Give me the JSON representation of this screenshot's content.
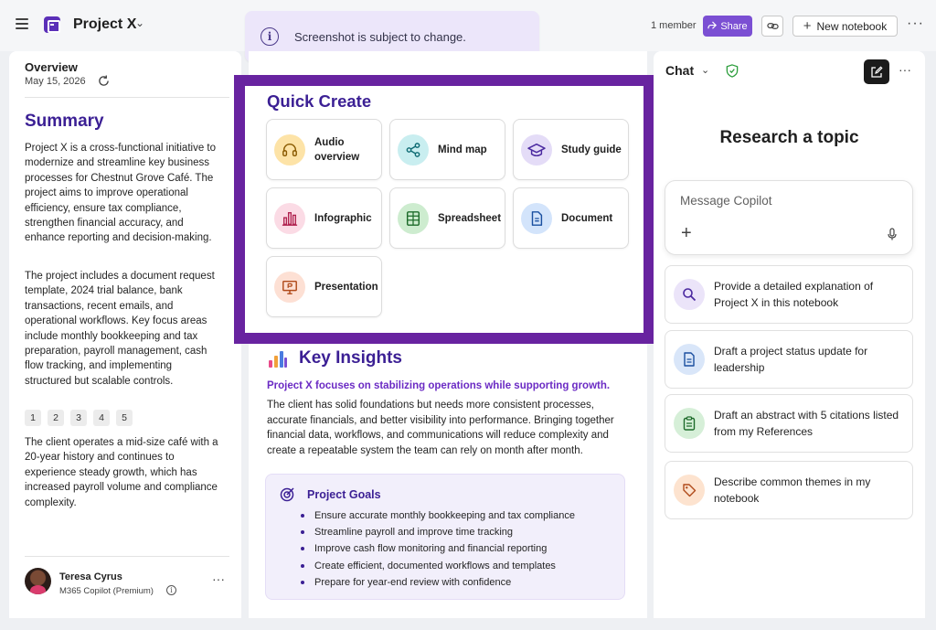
{
  "header": {
    "project_name": "Project X",
    "member_count": "1 member",
    "share_label": "Share",
    "new_notebook_label": "New notebook",
    "brand_color": "#5b2fb8",
    "share_color": "#7b4fd3"
  },
  "notice": {
    "text": "Screenshot is subject to change.",
    "icon": "info-icon"
  },
  "overview": {
    "title": "Overview",
    "date": "May 15, 2026",
    "summary_title": "Summary",
    "paragraphs": [
      "Project X is a cross-functional initiative to modernize and streamline key business processes for Chestnut Grove Café. The project aims to improve operational efficiency, ensure tax compliance, strengthen financial accuracy, and enhance reporting and decision-making.",
      "The project includes a document request template, 2024 trial balance, bank transactions, recent emails, and operational workflows. Key focus areas include monthly bookkeeping and tax preparation, payroll management, cash flow tracking, and implementing structured but scalable controls.",
      "The client operates a mid-size café with a 20-year history and continues to experience steady growth, which has increased payroll volume and compliance complexity."
    ],
    "citations": [
      "1",
      "2",
      "3",
      "4",
      "5"
    ]
  },
  "user": {
    "name": "Teresa Cyrus",
    "plan": "M365 Copilot (Premium)"
  },
  "quick_create": {
    "title": "Quick Create",
    "items": [
      {
        "label": "Audio overview",
        "icon": "headphones-icon",
        "color": "#fde3a7"
      },
      {
        "label": "Mind map",
        "icon": "share-nodes-icon",
        "color": "#c9eef0"
      },
      {
        "label": "Study guide",
        "icon": "graduation-cap-icon",
        "color": "#e4dcf7"
      },
      {
        "label": "Infographic",
        "icon": "bar-chart-icon",
        "color": "#fbdbe5"
      },
      {
        "label": "Spreadsheet",
        "icon": "spreadsheet-icon",
        "color": "#cdeccf"
      },
      {
        "label": "Document",
        "icon": "document-icon",
        "color": "#d3e4fb"
      },
      {
        "label": "Presentation",
        "icon": "presentation-icon",
        "color": "#fde0d4"
      }
    ]
  },
  "key_insights": {
    "title": "Key Insights",
    "subtitle": "Project X focuses on stabilizing operations while supporting growth.",
    "body": "The client has solid foundations but needs more consistent processes, accurate financials, and better visibility into performance. Bringing together financial data, workflows, and communications will reduce complexity and create a repeatable system the team can rely on month after month."
  },
  "goals": {
    "title": "Project Goals",
    "items": [
      "Ensure accurate monthly bookkeeping and tax compliance",
      "Streamline payroll and improve time tracking",
      "Improve cash flow monitoring and financial reporting",
      "Create efficient, documented workflows and templates",
      "Prepare for year-end review with confidence"
    ]
  },
  "chat": {
    "title": "Chat",
    "heading": "Research a topic",
    "placeholder": "Message Copilot",
    "suggestions": [
      {
        "text": "Provide a detailed explanation of Project X in this notebook",
        "icon": "search-icon",
        "color": "#ebe4f9"
      },
      {
        "text": "Draft a project status update for leadership",
        "icon": "document-icon",
        "color": "#d9e6f9"
      },
      {
        "text": "Draft an abstract with 5 citations listed from my References",
        "icon": "clipboard-icon",
        "color": "#d6efd8"
      },
      {
        "text": "Describe common themes in my notebook",
        "icon": "tag-icon",
        "color": "#fde3cf"
      }
    ]
  }
}
